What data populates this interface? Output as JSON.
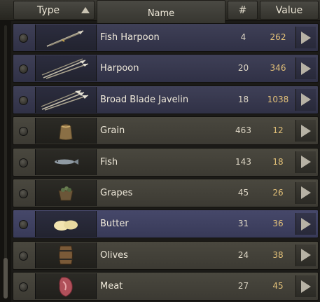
{
  "header": {
    "type": "Type",
    "name": "Name",
    "count": "#",
    "value": "Value"
  },
  "rows": [
    {
      "name": "Fish Harpoon",
      "count": "4",
      "value": "262",
      "icon": "harpoon-icon",
      "category": "weapon"
    },
    {
      "name": "Harpoon",
      "count": "20",
      "value": "346",
      "icon": "harpoons-icon",
      "category": "weapon"
    },
    {
      "name": "Broad Blade Javelin",
      "count": "18",
      "value": "1038",
      "icon": "javelins-icon",
      "category": "weapon"
    },
    {
      "name": "Grain",
      "count": "463",
      "value": "12",
      "icon": "grain-sack-icon",
      "category": "goods"
    },
    {
      "name": "Fish",
      "count": "143",
      "value": "18",
      "icon": "fish-icon",
      "category": "goods"
    },
    {
      "name": "Grapes",
      "count": "45",
      "value": "26",
      "icon": "grapes-basket-icon",
      "category": "goods"
    },
    {
      "name": "Butter",
      "count": "31",
      "value": "36",
      "icon": "butter-icon",
      "category": "goods",
      "selected": true
    },
    {
      "name": "Olives",
      "count": "24",
      "value": "38",
      "icon": "olive-barrel-icon",
      "category": "goods"
    },
    {
      "name": "Meat",
      "count": "27",
      "value": "45",
      "icon": "meat-icon",
      "category": "goods"
    }
  ],
  "colors": {
    "value_text": "#e3c179",
    "row_goods": "#4a483f",
    "row_weapon": "#3f4057",
    "row_selected": "#46486a"
  }
}
